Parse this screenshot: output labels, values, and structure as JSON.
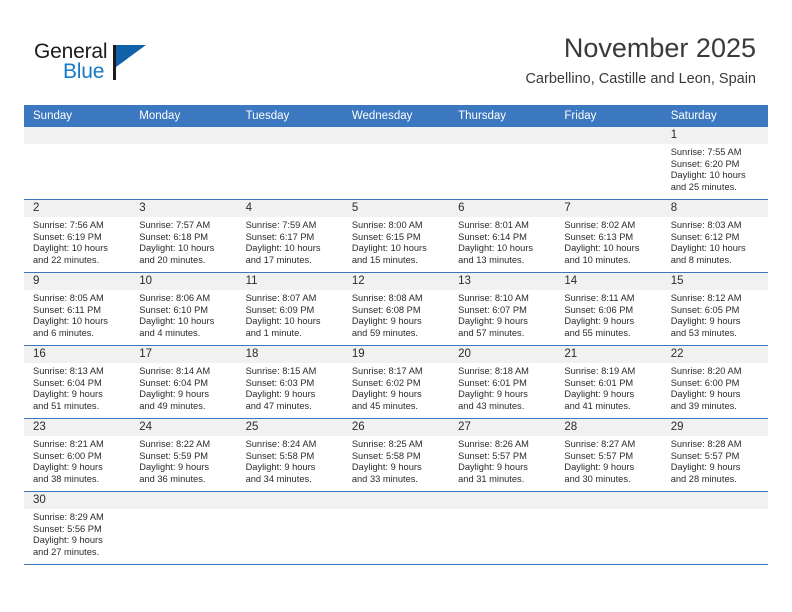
{
  "logo": {
    "word_top": "General",
    "word_bottom": "Blue",
    "accent_color": "#1878c4",
    "triangle_color": "#1161a8"
  },
  "header": {
    "title": "November 2025",
    "subtitle": "Carbellino, Castille and Leon, Spain",
    "header_bar_color": "#3b78bf"
  },
  "weekdays": [
    "Sunday",
    "Monday",
    "Tuesday",
    "Wednesday",
    "Thursday",
    "Friday",
    "Saturday"
  ],
  "labels": {
    "sunrise_prefix": "Sunrise:",
    "sunset_prefix": "Sunset:",
    "daylight_prefix": "Daylight:"
  },
  "weeks": [
    [
      {
        "day": "",
        "sunrise": "",
        "sunset": "",
        "daylight_line1": "",
        "daylight_line2": ""
      },
      {
        "day": "",
        "sunrise": "",
        "sunset": "",
        "daylight_line1": "",
        "daylight_line2": ""
      },
      {
        "day": "",
        "sunrise": "",
        "sunset": "",
        "daylight_line1": "",
        "daylight_line2": ""
      },
      {
        "day": "",
        "sunrise": "",
        "sunset": "",
        "daylight_line1": "",
        "daylight_line2": ""
      },
      {
        "day": "",
        "sunrise": "",
        "sunset": "",
        "daylight_line1": "",
        "daylight_line2": ""
      },
      {
        "day": "",
        "sunrise": "",
        "sunset": "",
        "daylight_line1": "",
        "daylight_line2": ""
      },
      {
        "day": "1",
        "sunrise": "Sunrise: 7:55 AM",
        "sunset": "Sunset: 6:20 PM",
        "daylight_line1": "Daylight: 10 hours",
        "daylight_line2": "and 25 minutes."
      }
    ],
    [
      {
        "day": "2",
        "sunrise": "Sunrise: 7:56 AM",
        "sunset": "Sunset: 6:19 PM",
        "daylight_line1": "Daylight: 10 hours",
        "daylight_line2": "and 22 minutes."
      },
      {
        "day": "3",
        "sunrise": "Sunrise: 7:57 AM",
        "sunset": "Sunset: 6:18 PM",
        "daylight_line1": "Daylight: 10 hours",
        "daylight_line2": "and 20 minutes."
      },
      {
        "day": "4",
        "sunrise": "Sunrise: 7:59 AM",
        "sunset": "Sunset: 6:17 PM",
        "daylight_line1": "Daylight: 10 hours",
        "daylight_line2": "and 17 minutes."
      },
      {
        "day": "5",
        "sunrise": "Sunrise: 8:00 AM",
        "sunset": "Sunset: 6:15 PM",
        "daylight_line1": "Daylight: 10 hours",
        "daylight_line2": "and 15 minutes."
      },
      {
        "day": "6",
        "sunrise": "Sunrise: 8:01 AM",
        "sunset": "Sunset: 6:14 PM",
        "daylight_line1": "Daylight: 10 hours",
        "daylight_line2": "and 13 minutes."
      },
      {
        "day": "7",
        "sunrise": "Sunrise: 8:02 AM",
        "sunset": "Sunset: 6:13 PM",
        "daylight_line1": "Daylight: 10 hours",
        "daylight_line2": "and 10 minutes."
      },
      {
        "day": "8",
        "sunrise": "Sunrise: 8:03 AM",
        "sunset": "Sunset: 6:12 PM",
        "daylight_line1": "Daylight: 10 hours",
        "daylight_line2": "and 8 minutes."
      }
    ],
    [
      {
        "day": "9",
        "sunrise": "Sunrise: 8:05 AM",
        "sunset": "Sunset: 6:11 PM",
        "daylight_line1": "Daylight: 10 hours",
        "daylight_line2": "and 6 minutes."
      },
      {
        "day": "10",
        "sunrise": "Sunrise: 8:06 AM",
        "sunset": "Sunset: 6:10 PM",
        "daylight_line1": "Daylight: 10 hours",
        "daylight_line2": "and 4 minutes."
      },
      {
        "day": "11",
        "sunrise": "Sunrise: 8:07 AM",
        "sunset": "Sunset: 6:09 PM",
        "daylight_line1": "Daylight: 10 hours",
        "daylight_line2": "and 1 minute."
      },
      {
        "day": "12",
        "sunrise": "Sunrise: 8:08 AM",
        "sunset": "Sunset: 6:08 PM",
        "daylight_line1": "Daylight: 9 hours",
        "daylight_line2": "and 59 minutes."
      },
      {
        "day": "13",
        "sunrise": "Sunrise: 8:10 AM",
        "sunset": "Sunset: 6:07 PM",
        "daylight_line1": "Daylight: 9 hours",
        "daylight_line2": "and 57 minutes."
      },
      {
        "day": "14",
        "sunrise": "Sunrise: 8:11 AM",
        "sunset": "Sunset: 6:06 PM",
        "daylight_line1": "Daylight: 9 hours",
        "daylight_line2": "and 55 minutes."
      },
      {
        "day": "15",
        "sunrise": "Sunrise: 8:12 AM",
        "sunset": "Sunset: 6:05 PM",
        "daylight_line1": "Daylight: 9 hours",
        "daylight_line2": "and 53 minutes."
      }
    ],
    [
      {
        "day": "16",
        "sunrise": "Sunrise: 8:13 AM",
        "sunset": "Sunset: 6:04 PM",
        "daylight_line1": "Daylight: 9 hours",
        "daylight_line2": "and 51 minutes."
      },
      {
        "day": "17",
        "sunrise": "Sunrise: 8:14 AM",
        "sunset": "Sunset: 6:04 PM",
        "daylight_line1": "Daylight: 9 hours",
        "daylight_line2": "and 49 minutes."
      },
      {
        "day": "18",
        "sunrise": "Sunrise: 8:15 AM",
        "sunset": "Sunset: 6:03 PM",
        "daylight_line1": "Daylight: 9 hours",
        "daylight_line2": "and 47 minutes."
      },
      {
        "day": "19",
        "sunrise": "Sunrise: 8:17 AM",
        "sunset": "Sunset: 6:02 PM",
        "daylight_line1": "Daylight: 9 hours",
        "daylight_line2": "and 45 minutes."
      },
      {
        "day": "20",
        "sunrise": "Sunrise: 8:18 AM",
        "sunset": "Sunset: 6:01 PM",
        "daylight_line1": "Daylight: 9 hours",
        "daylight_line2": "and 43 minutes."
      },
      {
        "day": "21",
        "sunrise": "Sunrise: 8:19 AM",
        "sunset": "Sunset: 6:01 PM",
        "daylight_line1": "Daylight: 9 hours",
        "daylight_line2": "and 41 minutes."
      },
      {
        "day": "22",
        "sunrise": "Sunrise: 8:20 AM",
        "sunset": "Sunset: 6:00 PM",
        "daylight_line1": "Daylight: 9 hours",
        "daylight_line2": "and 39 minutes."
      }
    ],
    [
      {
        "day": "23",
        "sunrise": "Sunrise: 8:21 AM",
        "sunset": "Sunset: 6:00 PM",
        "daylight_line1": "Daylight: 9 hours",
        "daylight_line2": "and 38 minutes."
      },
      {
        "day": "24",
        "sunrise": "Sunrise: 8:22 AM",
        "sunset": "Sunset: 5:59 PM",
        "daylight_line1": "Daylight: 9 hours",
        "daylight_line2": "and 36 minutes."
      },
      {
        "day": "25",
        "sunrise": "Sunrise: 8:24 AM",
        "sunset": "Sunset: 5:58 PM",
        "daylight_line1": "Daylight: 9 hours",
        "daylight_line2": "and 34 minutes."
      },
      {
        "day": "26",
        "sunrise": "Sunrise: 8:25 AM",
        "sunset": "Sunset: 5:58 PM",
        "daylight_line1": "Daylight: 9 hours",
        "daylight_line2": "and 33 minutes."
      },
      {
        "day": "27",
        "sunrise": "Sunrise: 8:26 AM",
        "sunset": "Sunset: 5:57 PM",
        "daylight_line1": "Daylight: 9 hours",
        "daylight_line2": "and 31 minutes."
      },
      {
        "day": "28",
        "sunrise": "Sunrise: 8:27 AM",
        "sunset": "Sunset: 5:57 PM",
        "daylight_line1": "Daylight: 9 hours",
        "daylight_line2": "and 30 minutes."
      },
      {
        "day": "29",
        "sunrise": "Sunrise: 8:28 AM",
        "sunset": "Sunset: 5:57 PM",
        "daylight_line1": "Daylight: 9 hours",
        "daylight_line2": "and 28 minutes."
      }
    ],
    [
      {
        "day": "30",
        "sunrise": "Sunrise: 8:29 AM",
        "sunset": "Sunset: 5:56 PM",
        "daylight_line1": "Daylight: 9 hours",
        "daylight_line2": "and 27 minutes."
      },
      {
        "day": "",
        "sunrise": "",
        "sunset": "",
        "daylight_line1": "",
        "daylight_line2": ""
      },
      {
        "day": "",
        "sunrise": "",
        "sunset": "",
        "daylight_line1": "",
        "daylight_line2": ""
      },
      {
        "day": "",
        "sunrise": "",
        "sunset": "",
        "daylight_line1": "",
        "daylight_line2": ""
      },
      {
        "day": "",
        "sunrise": "",
        "sunset": "",
        "daylight_line1": "",
        "daylight_line2": ""
      },
      {
        "day": "",
        "sunrise": "",
        "sunset": "",
        "daylight_line1": "",
        "daylight_line2": ""
      },
      {
        "day": "",
        "sunrise": "",
        "sunset": "",
        "daylight_line1": "",
        "daylight_line2": ""
      }
    ]
  ]
}
